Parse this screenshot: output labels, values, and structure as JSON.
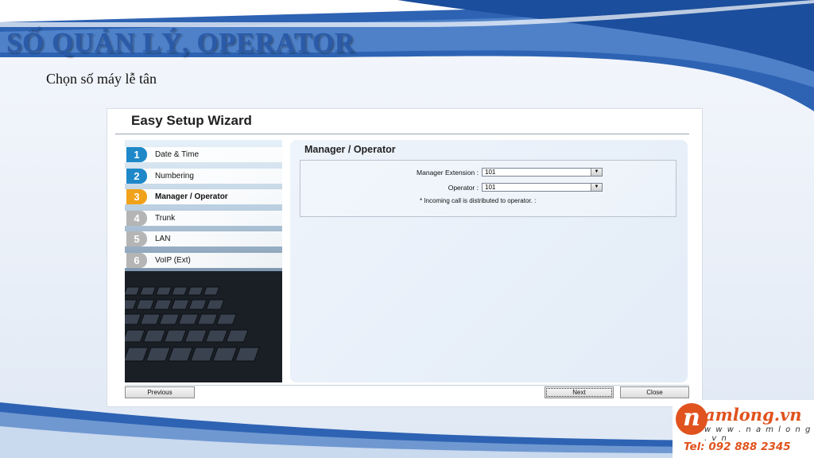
{
  "slide": {
    "title": "SỐ QUẢN LÝ, OPERATOR",
    "subtitle": "Chọn số máy lễ tân"
  },
  "wizard": {
    "title": "Easy Setup Wizard",
    "steps": [
      {
        "number": "1",
        "label": "Date & Time",
        "color": "#1e88c9"
      },
      {
        "number": "2",
        "label": "Numbering",
        "color": "#1e88c9"
      },
      {
        "number": "3",
        "label": "Manager / Operator",
        "color": "#f0a21a"
      },
      {
        "number": "4",
        "label": "Trunk",
        "color": "#b5b5b5"
      },
      {
        "number": "5",
        "label": "LAN",
        "color": "#b5b5b5"
      },
      {
        "number": "6",
        "label": "VoIP (Ext)",
        "color": "#b5b5b5"
      }
    ],
    "active_step": "3",
    "content": {
      "heading": "Manager / Operator",
      "manager_extension_label": "Manager Extension :",
      "manager_extension_value": "101",
      "operator_label": "Operator :",
      "operator_value": "101",
      "note": "* Incoming call is distributed to operator. :"
    },
    "buttons": {
      "previous": "Previous",
      "next": "Next",
      "close": "Close"
    }
  },
  "logo": {
    "mark": "n",
    "brand": "amlong.vn",
    "url": "w w w . n a m l o n g . v n",
    "tel": "Tel: 092 888 2345",
    "brand_color": "#e0531e"
  },
  "colors": {
    "title": "#2a5aa8",
    "accent_blue": "#1e5fae"
  }
}
